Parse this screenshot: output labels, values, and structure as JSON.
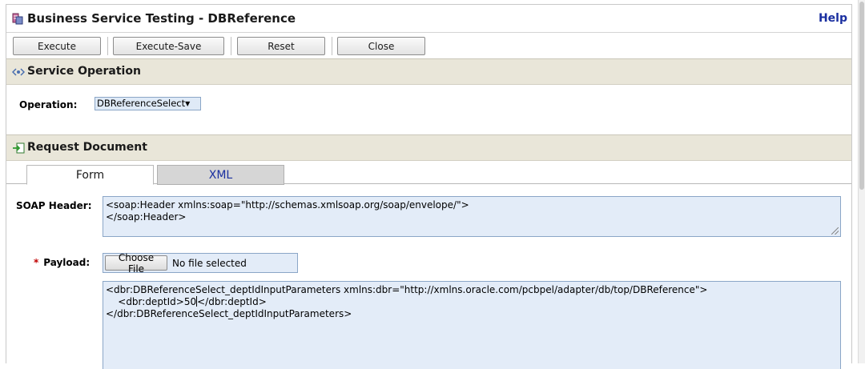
{
  "window": {
    "title": "Business Service Testing - DBReference",
    "help_label": "Help"
  },
  "toolbar": {
    "execute_label": "Execute",
    "execute_save_label": "Execute-Save",
    "reset_label": "Reset",
    "close_label": "Close"
  },
  "service_operation": {
    "title": "Service Operation",
    "operation_label": "Operation:",
    "operation_value": "DBReferenceSelect"
  },
  "request_document": {
    "title": "Request Document",
    "tabs": [
      {
        "label": "Form",
        "active": true
      },
      {
        "label": "XML",
        "active": false
      }
    ],
    "soap_header_label": "SOAP Header:",
    "soap_header_lines": [
      "<soap:Header xmlns:soap=\"http://schemas.xmlsoap.org/soap/envelope/\">",
      "</soap:Header>"
    ],
    "payload_required_marker": "*",
    "payload_label": "Payload:",
    "choose_file_label": "Choose File",
    "file_status": "No file selected",
    "payload_lines": [
      "<dbr:DBReferenceSelect_deptIdInputParameters xmlns:dbr=\"http://xmlns.oracle.com/pcbpel/adapter/db/top/DBReference\">",
      "    <dbr:deptId>50</dbr:deptId>",
      "</dbr:DBReferenceSelect_deptIdInputParameters>"
    ]
  },
  "colors": {
    "section_header_bg": "#e9e6d9",
    "input_bg": "#e3ecf8",
    "link_blue": "#1a2fa0",
    "required_red": "#c00000"
  }
}
